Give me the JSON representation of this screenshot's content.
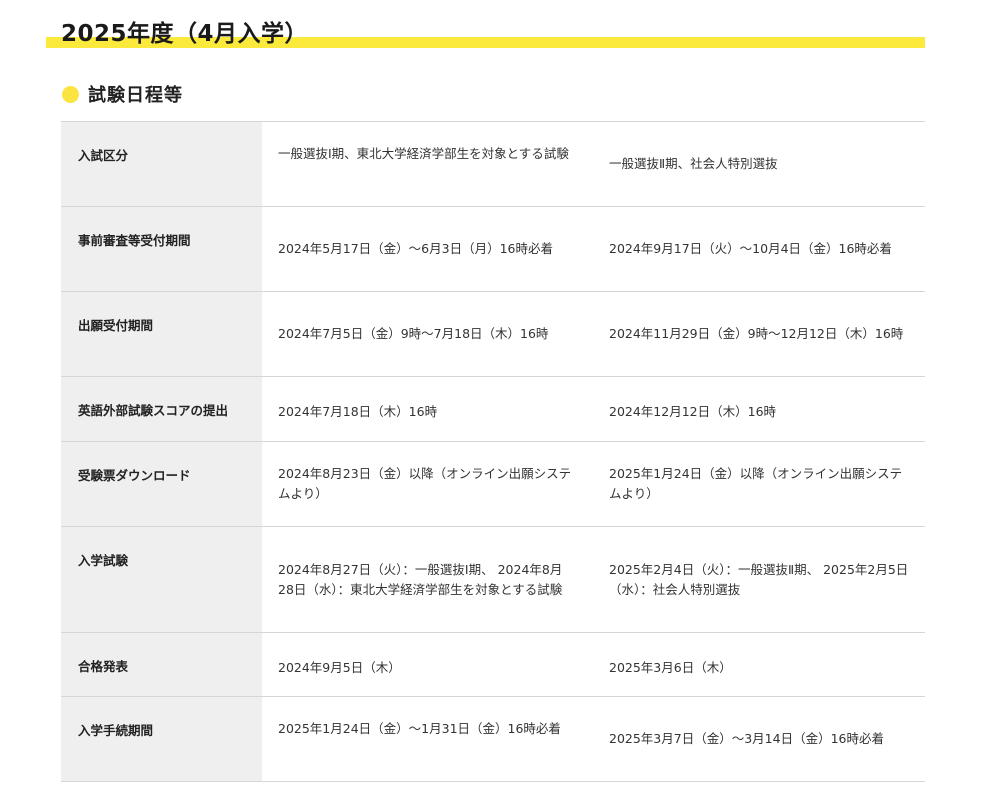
{
  "page_heading": {
    "title": "2025年度（4月入学）",
    "accent_color": "#fbea3c"
  },
  "section": {
    "title": "試験日程等",
    "bullet_color": "#fbe342"
  },
  "schedule": {
    "rows": [
      {
        "label": "入試区分",
        "col1": "一般選抜Ⅰ期、東北大学経済学部生を対象とする試験",
        "col2": "一般選抜Ⅱ期、社会人特別選抜"
      },
      {
        "label": "事前審査等受付期間",
        "col1": "2024年5月17日（金）～6月3日（月）16時必着",
        "col2": "2024年9月17日（火）～10月4日（金）16時必着"
      },
      {
        "label": "出願受付期間",
        "col1": "2024年7月5日（金）9時～7月18日（木）16時",
        "col2": "2024年11月29日（金）9時～12月12日（木）16時"
      },
      {
        "label": "英語外部試験スコアの提出",
        "col1": "2024年7月18日（木）16時",
        "col2": "2024年12月12日（木）16時"
      },
      {
        "label": "受験票ダウンロード",
        "col1": "2024年8月23日（金）以降（オンライン出願システムより）",
        "col2": "2025年1月24日（金）以降（オンライン出願システムより）"
      },
      {
        "label": "入学試験",
        "col1": "2024年8月27日（火）：一般選抜Ⅰ期、 2024年8月28日（水）：東北大学経済学部生を対象とする試験",
        "col2": "2025年2月4日（火）：一般選抜Ⅱ期、 2025年2月5日（水）：社会人特別選抜"
      },
      {
        "label": "合格発表",
        "col1": "2024年9月5日（木）",
        "col2": "2025年3月6日（木）"
      },
      {
        "label": "入学手続期間",
        "col1": "2025年1月24日（金）～1月31日（金）16時必着",
        "col2": "2025年3月7日（金）～3月14日（金）16時必着"
      }
    ]
  }
}
